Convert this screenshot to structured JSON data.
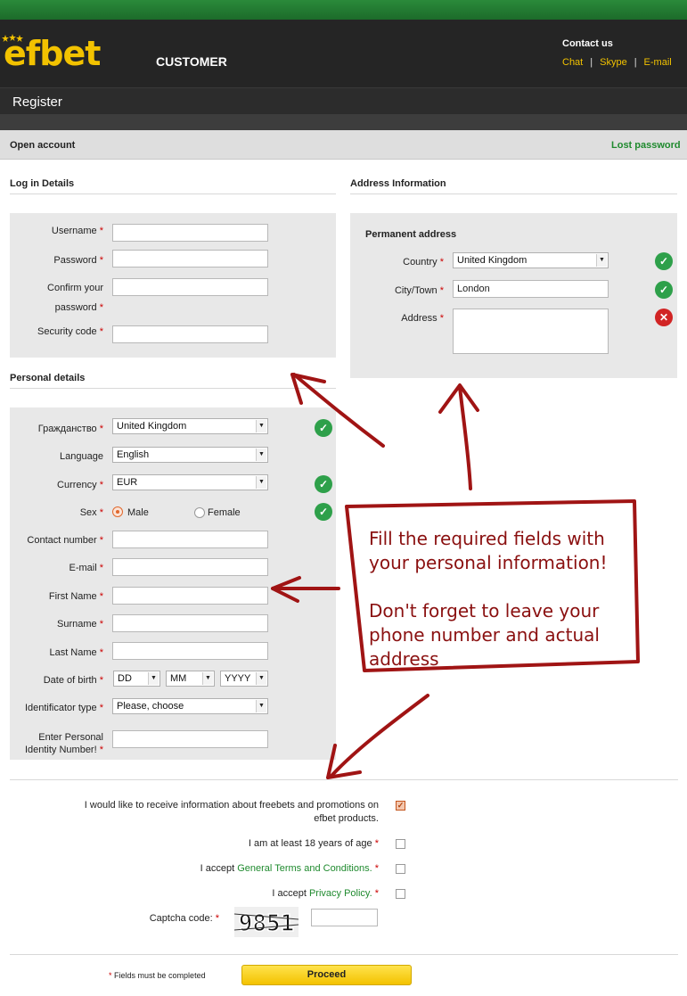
{
  "header": {
    "brand": "efbet",
    "section": "CUSTOMER",
    "contact_title": "Contact us",
    "contact_links": [
      "Chat",
      "Skype",
      "E-mail"
    ],
    "brand_color": "#f2c200",
    "accent_green": "#1f8a2e"
  },
  "page": {
    "title": "Register",
    "tab_left": "Open account",
    "tab_right": "Lost password"
  },
  "login": {
    "section_title": "Log in Details",
    "fields": [
      {
        "label": "Username",
        "value": ""
      },
      {
        "label": "Password",
        "value": ""
      },
      {
        "label_line1": "Confirm your",
        "label_line2": "password",
        "value": ""
      },
      {
        "label": "Security code",
        "value": ""
      }
    ]
  },
  "address": {
    "section_title": "Address Information",
    "subsection_title": "Permanent address",
    "country_label": "Country",
    "country_value": "United Kingdom",
    "city_label": "City/Town",
    "city_value": "London",
    "address_label": "Address",
    "address_value": ""
  },
  "personal": {
    "section_title": "Personal details",
    "citizenship_label": "Гражданство",
    "citizenship_value": "United Kingdom",
    "language_label": "Language",
    "language_value": "English",
    "currency_label": "Currency",
    "currency_value": "EUR",
    "sex_label": "Sex",
    "sex_options": [
      "Male",
      "Female"
    ],
    "sex_selected": "Male",
    "contact_label": "Contact number",
    "email_label": "E-mail",
    "firstname_label": "First Name",
    "surname_label": "Surname",
    "lastname_label": "Last Name",
    "dob_label": "Date of birth",
    "dob_day": "DD",
    "dob_month": "MM",
    "dob_year": "YYYY",
    "idtype_label": "Identificator type",
    "idtype_value": "Please, choose",
    "pin_label_line1": "Enter Personal",
    "pin_label_line2": "Identity Number!"
  },
  "agreements": {
    "promo_line1": "I would like to receive information about freebets and promotions on",
    "promo_line2": "efbet products.",
    "age": "I am at least 18 years of age",
    "terms_prefix": "I accept",
    "terms_link": "General Terms and Conditions.",
    "privacy_prefix": "I accept",
    "privacy_link": "Privacy Policy.",
    "captcha_label": "Captcha code:",
    "captcha_text": "9851"
  },
  "footer": {
    "required_note": "Fields must be completed",
    "proceed_label": "Proceed"
  },
  "annotation": {
    "line1": "Fill the required fields with",
    "line2": "your personal information!",
    "line3": "Don't forget to leave your",
    "line4": "phone number and actual",
    "line5": "address",
    "color": "#8a1010"
  }
}
